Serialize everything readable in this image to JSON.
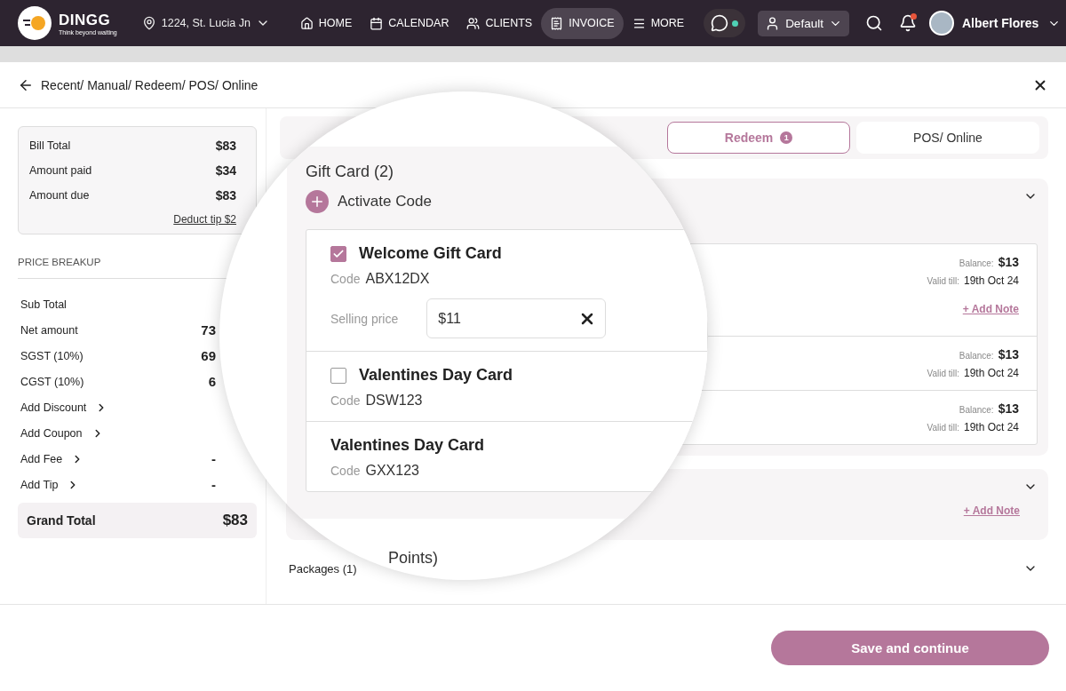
{
  "nav": {
    "brand": "DINGG",
    "tagline": "Think beyond waiting",
    "location": "1224, St. Lucia Jn",
    "items": [
      {
        "kind": "home",
        "label": "HOME",
        "selected": false
      },
      {
        "kind": "calendar",
        "label": "CALENDAR",
        "selected": false
      },
      {
        "kind": "clients",
        "label": "CLIENTS",
        "selected": false
      },
      {
        "kind": "invoice",
        "label": "INVOICE",
        "selected": true
      },
      {
        "kind": "more",
        "label": "MORE",
        "selected": false
      }
    ],
    "whatsapp_online": true,
    "profile": "Default",
    "notifications": true,
    "user": "Albert Flores"
  },
  "page": {
    "title": "Recent/ Manual/ Redeem/ POS/ Online"
  },
  "summary": {
    "rows": [
      {
        "label": "Bill Total",
        "value": "$83"
      },
      {
        "label": "Amount paid",
        "value": "$34"
      },
      {
        "label": "Amount due",
        "value": "$83"
      }
    ],
    "link": "Deduct tip $2"
  },
  "price_breakup": {
    "title": "PRICE BREAKUP",
    "rows": [
      {
        "label": "Sub Total",
        "kind": "plain"
      },
      {
        "label": "Net amount",
        "kind": "plain",
        "value": "73"
      },
      {
        "label": "SGST (10%)",
        "kind": "plain",
        "value": "69"
      },
      {
        "label": "CGST (10%)",
        "kind": "plain",
        "value": "6"
      },
      {
        "label": "Add Discount",
        "kind": "action"
      },
      {
        "label": "Add Coupon",
        "kind": "action"
      },
      {
        "label": "Add Fee",
        "kind": "action",
        "value": "-"
      },
      {
        "label": "Add Tip",
        "kind": "action",
        "value": "-"
      }
    ],
    "grand_total": {
      "label": "Grand Total",
      "value": "$83"
    }
  },
  "tabs": [
    {
      "label": "Redeem",
      "badge": "1",
      "selected": true
    },
    {
      "label": "POS/ Online",
      "selected": false
    }
  ],
  "gift_rows": [
    {
      "balance_label": "Balance:",
      "balance": "$13",
      "valid_label": "Valid till:",
      "valid": "19th Oct 24",
      "note": "+ Add Note"
    },
    {
      "balance_label": "Balance:",
      "balance": "$13",
      "valid_label": "Valid till:",
      "valid": "19th Oct 24"
    },
    {
      "balance_label": "Balance:",
      "balance": "$13",
      "valid_label": "Valid till:",
      "valid": "19th Oct 24"
    }
  ],
  "second_section": {
    "note": "+ Add Note"
  },
  "packages": {
    "label": "Packages (1)"
  },
  "magnifier": {
    "title": "Gift Card (2)",
    "action": "Activate Code",
    "cards": [
      {
        "kind": "checkbox",
        "checked": true,
        "name": "Welcome Gift Card",
        "code_label": "Code",
        "code": "ABX12DX",
        "price_label": "Selling price",
        "price": "$11"
      },
      {
        "kind": "checkbox",
        "checked": false,
        "name": "Valentines Day Card",
        "code_label": "Code",
        "code": "DSW123"
      },
      {
        "kind": "plain",
        "name": "Valentines Day Card",
        "code_label": "Code",
        "code": "GXX123"
      }
    ],
    "footer_text": "Points)"
  },
  "footer": {
    "button": "Save and continue"
  }
}
